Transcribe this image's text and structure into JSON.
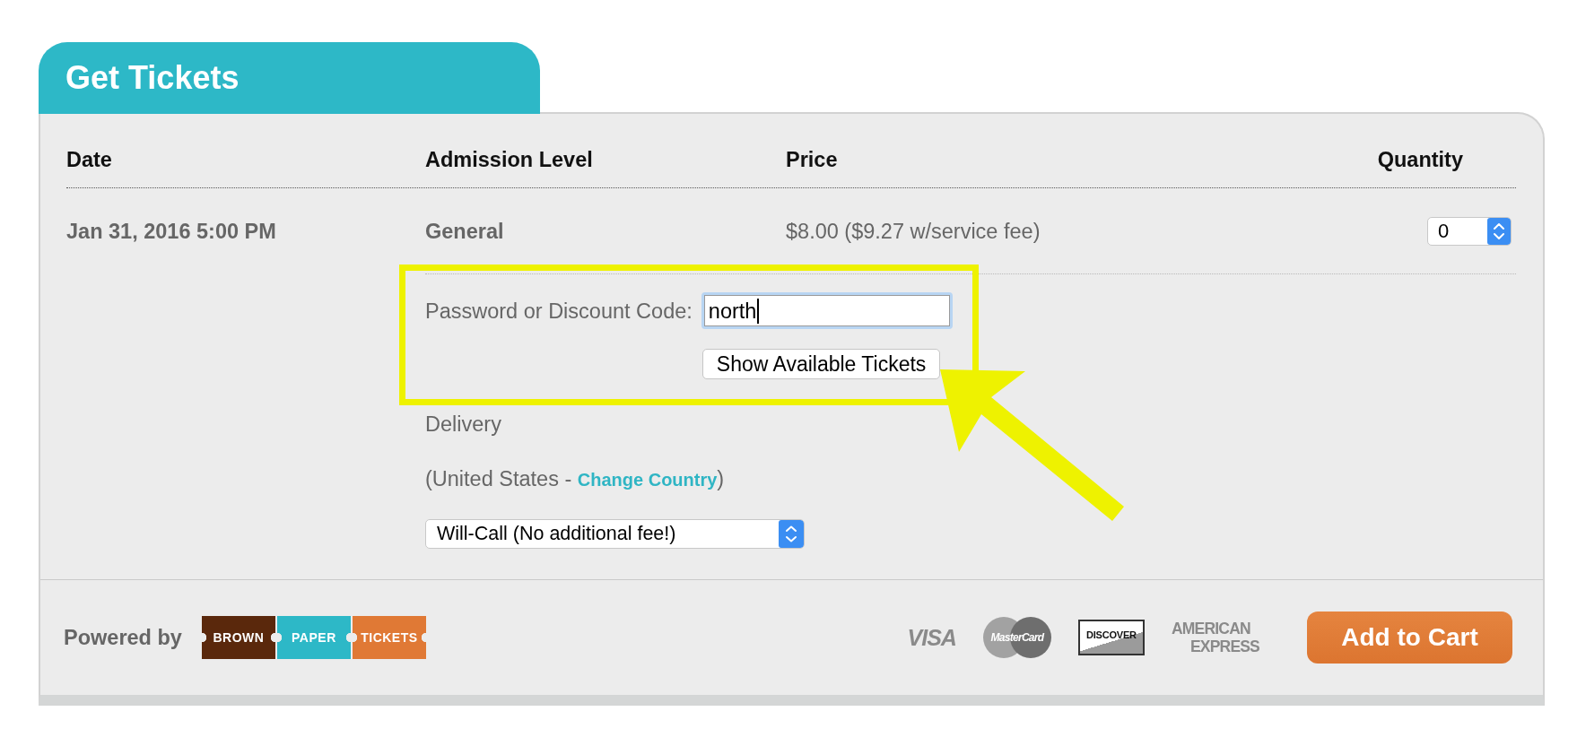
{
  "header": {
    "title": "Get Tickets"
  },
  "table": {
    "columns": [
      "Date",
      "Admission Level",
      "Price",
      "Quantity"
    ],
    "rows": [
      {
        "date": "Jan 31, 2016 5:00 PM",
        "admission_level": "General",
        "price": "$8.00 ($9.27 w/service fee)",
        "quantity": "0"
      }
    ]
  },
  "discount": {
    "label": "Password or Discount Code:",
    "value": "north",
    "focused": true,
    "button": "Show Available Tickets"
  },
  "delivery": {
    "label": "Delivery",
    "country_before": "(United States - ",
    "country_link": "Change Country",
    "country_after": ")",
    "method": "Will-Call (No additional fee!)"
  },
  "footer": {
    "powered_by": "Powered by",
    "logo": [
      {
        "text": "BROWN",
        "color": "#5a280c"
      },
      {
        "text": "PAPER",
        "color": "#2db8c7"
      },
      {
        "text": "TICKETS",
        "color": "#e07935"
      }
    ],
    "payment_logos": [
      {
        "kind": "visa",
        "lines": [
          "VISA"
        ]
      },
      {
        "kind": "mastercard",
        "lines": [
          "MasterCard"
        ]
      },
      {
        "kind": "discover",
        "lines": [
          "DISCOVER"
        ]
      },
      {
        "kind": "amex",
        "lines": [
          "AMERICAN",
          "EXPRESS"
        ]
      }
    ],
    "button": "Add to Cart"
  },
  "annotations": {
    "highlight_box": true,
    "arrow": true
  }
}
